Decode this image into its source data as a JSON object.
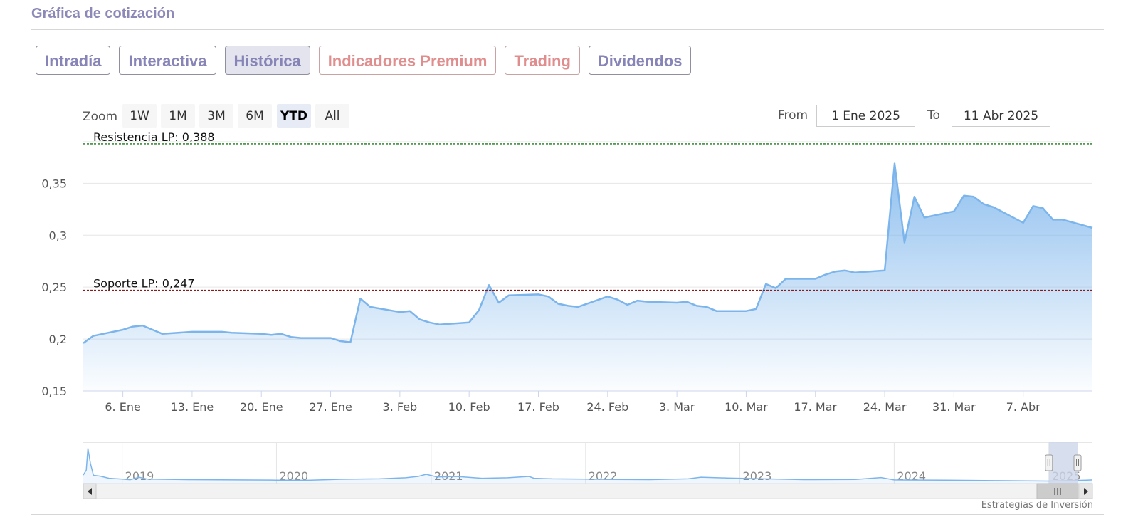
{
  "page": {
    "title": "Gráfica de cotización",
    "credit": "Estrategias de Inversión"
  },
  "tabs": [
    {
      "label": "Intradía",
      "active": false,
      "style": "normal"
    },
    {
      "label": "Interactiva",
      "active": false,
      "style": "normal"
    },
    {
      "label": "Histórica",
      "active": true,
      "style": "normal"
    },
    {
      "label": "Indicadores Premium",
      "active": false,
      "style": "premium"
    },
    {
      "label": "Trading",
      "active": false,
      "style": "premium"
    },
    {
      "label": "Dividendos",
      "active": false,
      "style": "normal"
    }
  ],
  "range_selector": {
    "zoom_label": "Zoom",
    "buttons": [
      {
        "label": "1W",
        "active": false
      },
      {
        "label": "1M",
        "active": false
      },
      {
        "label": "3M",
        "active": false
      },
      {
        "label": "6M",
        "active": false
      },
      {
        "label": "YTD",
        "active": true
      },
      {
        "label": "All",
        "active": false
      }
    ],
    "from_label": "From",
    "from_value": "1 Ene 2025",
    "to_label": "To",
    "to_value": "11 Abr 2025"
  },
  "colors": {
    "line": "#7cb5ec",
    "area_top": "#7cb5ec",
    "resistance": "#1a7a1a",
    "support": "#8b1a1a",
    "navigator_mask": "#cdd6ea"
  },
  "chart_data": {
    "type": "area",
    "x_range": [
      "2025-01-01",
      "2025-04-11"
    ],
    "ylim": [
      0.15,
      0.39
    ],
    "yticks": [
      "0,15",
      "0,2",
      "0,25",
      "0,3",
      "0,35"
    ],
    "xticks": [
      "6. Ene",
      "13. Ene",
      "20. Ene",
      "27. Ene",
      "3. Feb",
      "10. Feb",
      "17. Feb",
      "24. Feb",
      "3. Mar",
      "10. Mar",
      "17. Mar",
      "24. Mar",
      "31. Mar",
      "7. Abr"
    ],
    "grid": true,
    "series": [
      {
        "values": [
          [
            "2025-01-02",
            0.196
          ],
          [
            "2025-01-03",
            0.203
          ],
          [
            "2025-01-06",
            0.209
          ],
          [
            "2025-01-07",
            0.212
          ],
          [
            "2025-01-08",
            0.213
          ],
          [
            "2025-01-09",
            0.209
          ],
          [
            "2025-01-10",
            0.205
          ],
          [
            "2025-01-13",
            0.207
          ],
          [
            "2025-01-14",
            0.207
          ],
          [
            "2025-01-15",
            0.207
          ],
          [
            "2025-01-16",
            0.207
          ],
          [
            "2025-01-17",
            0.206
          ],
          [
            "2025-01-20",
            0.205
          ],
          [
            "2025-01-21",
            0.204
          ],
          [
            "2025-01-22",
            0.205
          ],
          [
            "2025-01-23",
            0.202
          ],
          [
            "2025-01-24",
            0.201
          ],
          [
            "2025-01-27",
            0.201
          ],
          [
            "2025-01-28",
            0.198
          ],
          [
            "2025-01-29",
            0.197
          ],
          [
            "2025-01-30",
            0.239
          ],
          [
            "2025-01-31",
            0.231
          ],
          [
            "2025-02-03",
            0.226
          ],
          [
            "2025-02-04",
            0.227
          ],
          [
            "2025-02-05",
            0.219
          ],
          [
            "2025-02-06",
            0.216
          ],
          [
            "2025-02-07",
            0.214
          ],
          [
            "2025-02-10",
            0.216
          ],
          [
            "2025-02-11",
            0.228
          ],
          [
            "2025-02-12",
            0.252
          ],
          [
            "2025-02-13",
            0.235
          ],
          [
            "2025-02-14",
            0.242
          ],
          [
            "2025-02-17",
            0.243
          ],
          [
            "2025-02-18",
            0.241
          ],
          [
            "2025-02-19",
            0.234
          ],
          [
            "2025-02-20",
            0.232
          ],
          [
            "2025-02-21",
            0.231
          ],
          [
            "2025-02-24",
            0.241
          ],
          [
            "2025-02-25",
            0.238
          ],
          [
            "2025-02-26",
            0.233
          ],
          [
            "2025-02-27",
            0.237
          ],
          [
            "2025-02-28",
            0.236
          ],
          [
            "2025-03-03",
            0.235
          ],
          [
            "2025-03-04",
            0.236
          ],
          [
            "2025-03-05",
            0.232
          ],
          [
            "2025-03-06",
            0.231
          ],
          [
            "2025-03-07",
            0.227
          ],
          [
            "2025-03-10",
            0.227
          ],
          [
            "2025-03-11",
            0.229
          ],
          [
            "2025-03-12",
            0.253
          ],
          [
            "2025-03-13",
            0.249
          ],
          [
            "2025-03-14",
            0.258
          ],
          [
            "2025-03-17",
            0.258
          ],
          [
            "2025-03-18",
            0.262
          ],
          [
            "2025-03-19",
            0.265
          ],
          [
            "2025-03-20",
            0.266
          ],
          [
            "2025-03-21",
            0.264
          ],
          [
            "2025-03-24",
            0.266
          ],
          [
            "2025-03-25",
            0.369
          ],
          [
            "2025-03-26",
            0.293
          ],
          [
            "2025-03-27",
            0.337
          ],
          [
            "2025-03-28",
            0.317
          ],
          [
            "2025-03-31",
            0.323
          ],
          [
            "2025-04-01",
            0.338
          ],
          [
            "2025-04-02",
            0.337
          ],
          [
            "2025-04-03",
            0.33
          ],
          [
            "2025-04-04",
            0.327
          ],
          [
            "2025-04-07",
            0.312
          ],
          [
            "2025-04-08",
            0.328
          ],
          [
            "2025-04-09",
            0.326
          ],
          [
            "2025-04-10",
            0.315
          ],
          [
            "2025-04-11",
            0.315
          ],
          [
            "2025-04-14",
            0.307
          ]
        ]
      }
    ],
    "plot_lines": [
      {
        "label": "Resistencia LP: 0,388",
        "value": 0.388,
        "color": "#1a7a1a",
        "dash": true
      },
      {
        "label": "Soporte LP: 0,247",
        "value": 0.247,
        "color": "#8b1a1a",
        "dash": true
      }
    ],
    "navigator": {
      "years": [
        "2019",
        "2020",
        "2021",
        "2022",
        "2023",
        "2024",
        "2025"
      ],
      "ylim": [
        0.1,
        3.5
      ],
      "values": [
        [
          "2018-10-01",
          0.75
        ],
        [
          "2018-10-08",
          1.2
        ],
        [
          "2018-10-12",
          3.2
        ],
        [
          "2018-10-18",
          1.8
        ],
        [
          "2018-10-25",
          0.72
        ],
        [
          "2018-11-10",
          0.65
        ],
        [
          "2018-12-01",
          0.45
        ],
        [
          "2019-01-01",
          0.38
        ],
        [
          "2019-01-20",
          0.32
        ],
        [
          "2019-02-10",
          0.55
        ],
        [
          "2019-03-01",
          0.38
        ],
        [
          "2019-06-01",
          0.33
        ],
        [
          "2019-10-01",
          0.3
        ],
        [
          "2020-01-01",
          0.28
        ],
        [
          "2020-03-15",
          0.27
        ],
        [
          "2020-06-01",
          0.36
        ],
        [
          "2020-09-01",
          0.4
        ],
        [
          "2020-11-01",
          0.5
        ],
        [
          "2020-12-01",
          0.62
        ],
        [
          "2020-12-20",
          0.82
        ],
        [
          "2021-01-15",
          0.58
        ],
        [
          "2021-03-01",
          0.62
        ],
        [
          "2021-05-01",
          0.45
        ],
        [
          "2021-07-01",
          0.5
        ],
        [
          "2021-08-20",
          0.62
        ],
        [
          "2021-09-01",
          0.45
        ],
        [
          "2021-10-15",
          0.4
        ],
        [
          "2022-01-01",
          0.38
        ],
        [
          "2022-03-01",
          0.35
        ],
        [
          "2022-06-01",
          0.33
        ],
        [
          "2022-09-01",
          0.4
        ],
        [
          "2022-10-01",
          0.55
        ],
        [
          "2022-12-01",
          0.48
        ],
        [
          "2023-03-01",
          0.4
        ],
        [
          "2023-06-01",
          0.33
        ],
        [
          "2023-10-01",
          0.35
        ],
        [
          "2023-12-01",
          0.52
        ],
        [
          "2024-01-01",
          0.3
        ],
        [
          "2024-05-01",
          0.28
        ],
        [
          "2024-09-01",
          0.24
        ],
        [
          "2024-12-31",
          0.2
        ],
        [
          "2025-03-24",
          0.27
        ],
        [
          "2025-04-14",
          0.3
        ]
      ]
    }
  }
}
